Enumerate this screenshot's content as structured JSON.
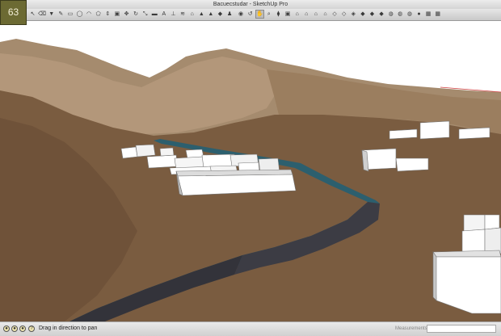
{
  "badge": "63",
  "window": {
    "title": "Bacuecstudar - SketchUp Pro"
  },
  "toolbar": {
    "tools": [
      {
        "name": "select-icon",
        "glyph": "↖"
      },
      {
        "name": "eraser-icon",
        "glyph": "⌫"
      },
      {
        "name": "paint-bucket-icon",
        "glyph": "▼"
      },
      {
        "name": "pencil-icon",
        "glyph": "✎"
      },
      {
        "name": "rectangle-icon",
        "glyph": "▭"
      },
      {
        "name": "circle-icon",
        "glyph": "◯"
      },
      {
        "name": "arc-icon",
        "glyph": "◠"
      },
      {
        "name": "polygon-icon",
        "glyph": "⬠"
      },
      {
        "name": "push-pull-icon",
        "glyph": "⇕"
      },
      {
        "name": "offset-icon",
        "glyph": "▣"
      },
      {
        "name": "move-icon",
        "glyph": "✥"
      },
      {
        "name": "rotate-icon",
        "glyph": "↻"
      },
      {
        "name": "scale-icon",
        "glyph": "⤡"
      },
      {
        "name": "tape-measure-icon",
        "glyph": "▬"
      },
      {
        "name": "text-icon",
        "glyph": "A"
      },
      {
        "name": "axes-icon",
        "glyph": "⊥"
      },
      {
        "name": "sandbox-smoove-icon",
        "glyph": "≋"
      },
      {
        "name": "sandbox-stamp-icon",
        "glyph": "⌂"
      },
      {
        "name": "sandbox-drape-icon",
        "glyph": "▲"
      },
      {
        "name": "sandbox-add-detail-icon",
        "glyph": "▲"
      },
      {
        "name": "sandbox-flip-edge-icon",
        "glyph": "◆"
      },
      {
        "name": "walk-icon",
        "glyph": "♟"
      },
      {
        "name": "look-around-icon",
        "glyph": "◉"
      },
      {
        "name": "orbit-icon",
        "glyph": "↺"
      },
      {
        "name": "pan-icon",
        "glyph": "✋"
      },
      {
        "name": "zoom-icon",
        "glyph": "⌕"
      },
      {
        "name": "iso-view-icon",
        "glyph": "⧫"
      },
      {
        "name": "top-view-icon",
        "glyph": "▣"
      },
      {
        "name": "front-view-icon",
        "glyph": "⌂"
      },
      {
        "name": "right-view-icon",
        "glyph": "⌂"
      },
      {
        "name": "back-view-icon",
        "glyph": "⌂"
      },
      {
        "name": "left-view-icon",
        "glyph": "⌂"
      },
      {
        "name": "xray-style-icon",
        "glyph": "◇"
      },
      {
        "name": "wireframe-style-icon",
        "glyph": "◇"
      },
      {
        "name": "hidden-line-style-icon",
        "glyph": "◈"
      },
      {
        "name": "shaded-style-icon",
        "glyph": "◆"
      },
      {
        "name": "textured-style-icon",
        "glyph": "◆"
      },
      {
        "name": "monochrome-style-icon",
        "glyph": "◆"
      },
      {
        "name": "get-models-icon",
        "glyph": "◍"
      },
      {
        "name": "share-model-icon",
        "glyph": "◍"
      },
      {
        "name": "share-component-icon",
        "glyph": "◍"
      },
      {
        "name": "preview-google-earth-icon",
        "glyph": "●"
      },
      {
        "name": "photo-textures-icon",
        "glyph": "▦"
      },
      {
        "name": "extension-warehouse-icon",
        "glyph": "▦"
      }
    ]
  },
  "status": {
    "message": "Drag in direction to pan",
    "measurements_label": "Measurements",
    "measurements_value": ""
  }
}
